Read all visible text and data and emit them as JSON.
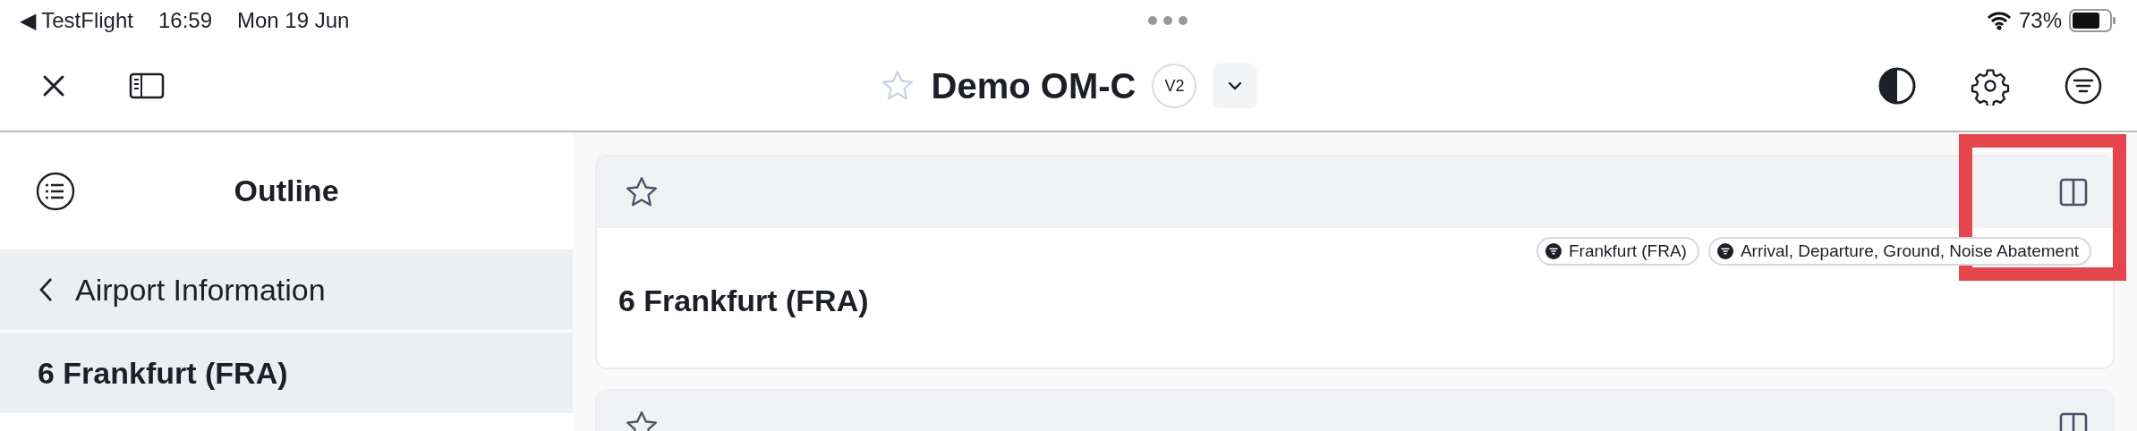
{
  "status_bar": {
    "back_app": "◀ TestFlight",
    "time": "16:59",
    "date": "Mon 19 Jun",
    "battery": "73%"
  },
  "toolbar": {
    "title": "Demo OM-C",
    "version": "V2"
  },
  "sidebar": {
    "title": "Outline",
    "items": [
      {
        "kind": "back",
        "label": "Airport Information"
      },
      {
        "kind": "current",
        "label": "6 Frankfurt (FRA)"
      }
    ]
  },
  "cards": [
    {
      "kind": "full",
      "title": "6 Frankfurt (FRA)",
      "tags": [
        "Frankfurt (FRA)",
        "Arrival, Departure, Ground, Noise Abatement"
      ]
    },
    {
      "kind": "header_only"
    }
  ],
  "annotation": {
    "kind": "highlight"
  }
}
